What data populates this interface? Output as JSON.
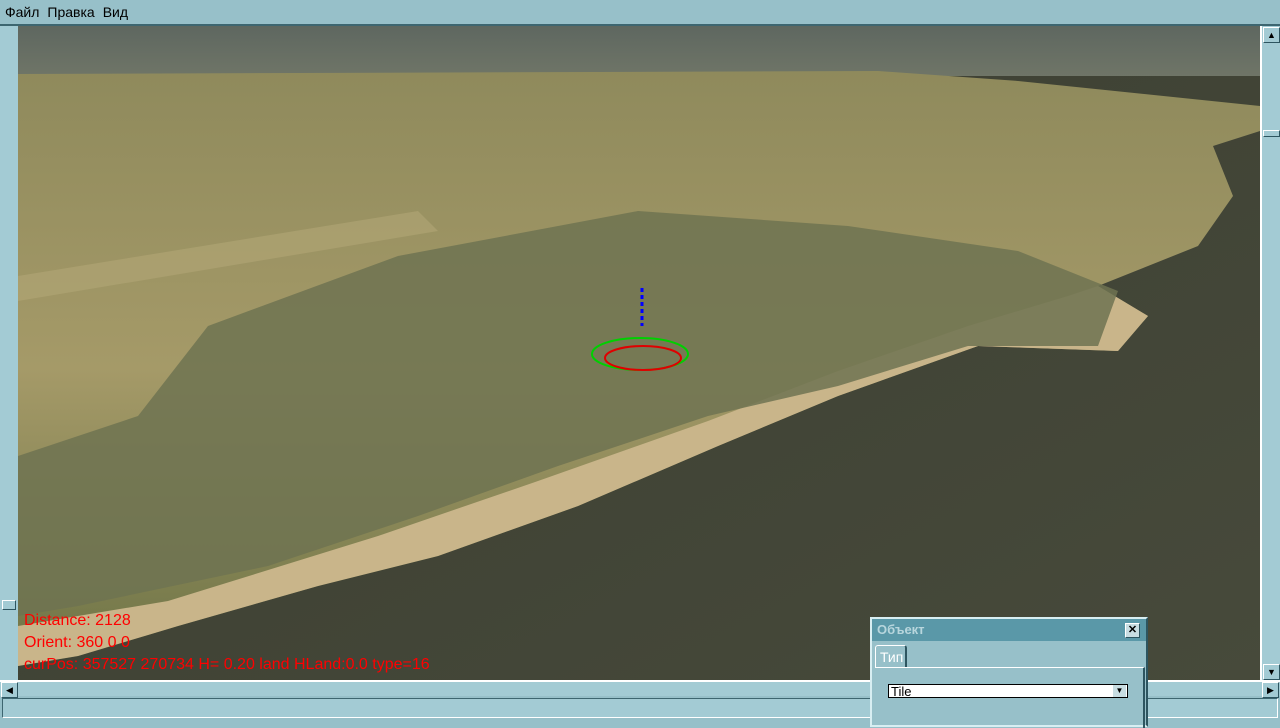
{
  "menu": {
    "items": [
      "Файл",
      "Правка",
      "Вид"
    ]
  },
  "overlay": {
    "distance": "Distance: 2128",
    "orient": "Orient: 360 0 0",
    "curpos": "curPos: 357527 270734 H= 0.20 land HLand:0.0 type=16",
    "color": "#ff0000"
  },
  "dialog": {
    "title": "Объект",
    "tab": "Тип",
    "type_select": "Tile"
  },
  "icons": {
    "close": "close-icon",
    "up": "arrow-up-icon",
    "down": "arrow-down-icon",
    "left": "arrow-left-icon",
    "right": "arrow-right-icon"
  }
}
